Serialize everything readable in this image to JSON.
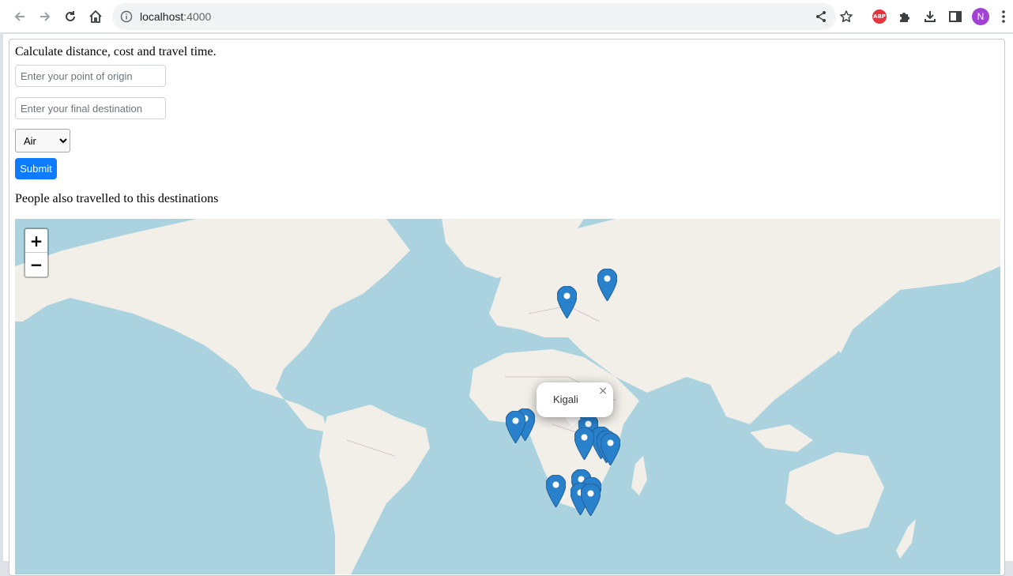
{
  "browser": {
    "url_host": "localhost",
    "url_port": ":4000",
    "profile_initial": "N",
    "adblock_label": "ABP"
  },
  "form": {
    "heading": "Calculate distance, cost and travel time.",
    "origin_placeholder": "Enter your point of origin",
    "destination_placeholder": "Enter your final destination",
    "mode_selected": "Air",
    "submit_label": "Submit"
  },
  "section": {
    "popular_heading": "People also travelled to this destinations"
  },
  "map": {
    "zoom_in_label": "+",
    "zoom_out_label": "−",
    "popup": {
      "text": "Kigali",
      "close_label": "×"
    },
    "marker_count": 14,
    "colors": {
      "water": "#aad3df",
      "land": "#f2efe9",
      "marker": "#2a81cb"
    }
  }
}
